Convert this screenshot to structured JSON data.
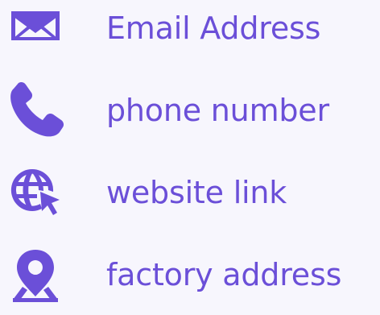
{
  "theme": {
    "accent": "#6b4fd8",
    "background": "#f7f6fd"
  },
  "contacts": [
    {
      "icon": "envelope-icon",
      "label": "Email Address"
    },
    {
      "icon": "phone-icon",
      "label": "phone number"
    },
    {
      "icon": "globe-cursor-icon",
      "label": "website link"
    },
    {
      "icon": "map-pin-icon",
      "label": "factory address"
    }
  ]
}
